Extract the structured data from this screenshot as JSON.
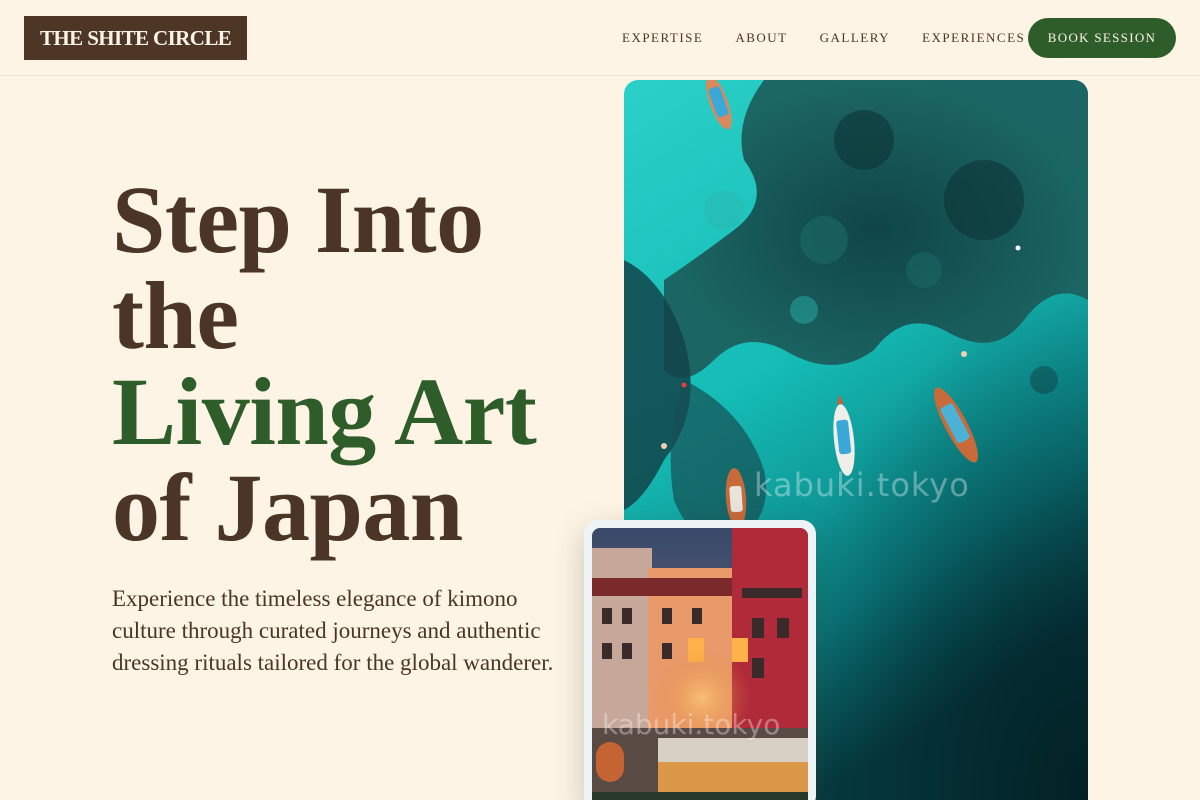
{
  "header": {
    "logo": "THE SHITE CIRCLE",
    "nav": [
      {
        "label": "EXPERTISE"
      },
      {
        "label": "ABOUT"
      },
      {
        "label": "GALLERY"
      },
      {
        "label": "EXPERIENCES"
      }
    ],
    "cta": "BOOK SESSION"
  },
  "hero": {
    "title_lines": [
      "Step Into",
      "the",
      "Living Art",
      "of Japan"
    ],
    "description": "Experience the timeless elegance of kimono culture through curated journeys and authentic dressing rituals tailored for the global wanderer."
  },
  "images": {
    "main": {
      "subject": "aerial-turquoise-sea-with-boats",
      "watermark": "kabuki.tokyo"
    },
    "inset": {
      "subject": "colorful-waterfront-buildings-at-dusk",
      "watermark": "kabuki.tokyo"
    }
  },
  "colors": {
    "background": "#fdf4e6",
    "brown": "#4a3526",
    "green": "#2f5d2a",
    "sea": "#1fc4c0"
  }
}
